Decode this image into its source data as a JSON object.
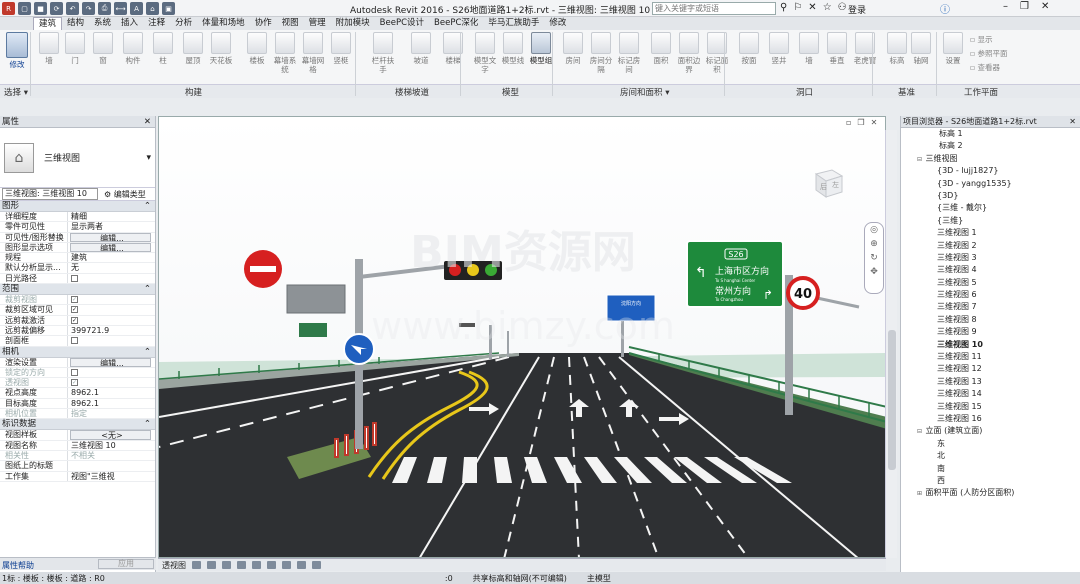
{
  "app": {
    "title": "Autodesk Revit 2016 -    S26地面道路1+2标.rvt - 三维视图: 三维视图 10",
    "search_placeholder": "键入关键字或短语",
    "login": "登录"
  },
  "tabs": [
    "建筑",
    "结构",
    "系统",
    "插入",
    "注释",
    "分析",
    "体量和场地",
    "协作",
    "视图",
    "管理",
    "附加模块",
    "BeePC设计",
    "BeePC深化",
    "毕马汇族助手",
    "修改"
  ],
  "active_tab": "建筑",
  "ribbon": {
    "modify": "修改",
    "select": "选择",
    "buttons": [
      "墙",
      "门",
      "窗",
      "构件",
      "柱",
      "屋顶",
      "天花板",
      "楼板",
      "幕墙系统",
      "幕墙网格",
      "竖梃",
      "栏杆扶手",
      "坡道",
      "楼梯",
      "模型文字",
      "模型线",
      "模型组",
      "房间",
      "房间分隔",
      "标记房间",
      "面积",
      "面积边界",
      "标记面积",
      "按面",
      "竖井",
      "墙",
      "垂直",
      "老虎窗",
      "标高",
      "轴网",
      "设置"
    ],
    "mini_buttons": [
      "显示",
      "参照平面",
      "查看器"
    ],
    "groups": [
      "构建",
      "楼梯坡道",
      "模型",
      "房间和面积",
      "洞口",
      "基准",
      "工作平面"
    ]
  },
  "properties": {
    "title": "属性",
    "type_name": "三维视图",
    "selector": "三维视图: 三维视图 10",
    "edit_type": "编辑类型",
    "help": "属性帮助",
    "apply": "应用",
    "sections": [
      {
        "name": "图形",
        "rows": [
          {
            "k": "详细程度",
            "v": "精细"
          },
          {
            "k": "零件可见性",
            "v": "显示两者"
          },
          {
            "k": "可见性/图形替换",
            "v": "编辑...",
            "btn": true
          },
          {
            "k": "图形显示选项",
            "v": "编辑...",
            "btn": true
          },
          {
            "k": "规程",
            "v": "建筑"
          },
          {
            "k": "默认分析显示...",
            "v": "无"
          },
          {
            "k": "日光路径",
            "v": "",
            "chk": false
          }
        ]
      },
      {
        "name": "范围",
        "rows": [
          {
            "k": "裁剪视图",
            "v": "",
            "chk": true,
            "dis": true
          },
          {
            "k": "裁剪区域可见",
            "v": "",
            "chk": true
          },
          {
            "k": "远剪裁激活",
            "v": "",
            "chk": true
          },
          {
            "k": "远剪裁偏移",
            "v": "399721.9"
          },
          {
            "k": "剖面框",
            "v": "",
            "chk": false
          }
        ]
      },
      {
        "name": "相机",
        "rows": [
          {
            "k": "渲染设置",
            "v": "编辑...",
            "btn": true
          },
          {
            "k": "锁定的方向",
            "v": "",
            "chk": false,
            "dis": true
          },
          {
            "k": "透视图",
            "v": "",
            "chk": true,
            "dis": true
          },
          {
            "k": "视点高度",
            "v": "8962.1"
          },
          {
            "k": "目标高度",
            "v": "8962.1"
          },
          {
            "k": "相机位置",
            "v": "指定",
            "dis": true
          }
        ]
      },
      {
        "name": "标识数据",
        "rows": [
          {
            "k": "视图样板",
            "v": "<无>",
            "btn": true
          },
          {
            "k": "视图名称",
            "v": "三维视图 10"
          },
          {
            "k": "相关性",
            "v": "不相关",
            "dis": true
          },
          {
            "k": "图纸上的标题",
            "v": ""
          },
          {
            "k": "工作集",
            "v": "视图\"三维视"
          }
        ]
      }
    ]
  },
  "browser": {
    "title": "项目浏览器 - S26地面道路1+2标.rvt",
    "items": [
      {
        "t": "标高 1",
        "lvl": 3
      },
      {
        "t": "标高 2",
        "lvl": 3
      },
      {
        "t": "三维视图",
        "lvl": 1,
        "tog": "⊟"
      },
      {
        "t": "{3D - lujj1827}",
        "lvl": 2
      },
      {
        "t": "{3D - yangg1535}",
        "lvl": 2
      },
      {
        "t": "{3D}",
        "lvl": 2
      },
      {
        "t": "{三维 - 戴尔}",
        "lvl": 2
      },
      {
        "t": "{三维}",
        "lvl": 2
      },
      {
        "t": "三维视图 1",
        "lvl": 2
      },
      {
        "t": "三维视图 2",
        "lvl": 2
      },
      {
        "t": "三维视图 3",
        "lvl": 2
      },
      {
        "t": "三维视图 4",
        "lvl": 2
      },
      {
        "t": "三维视图 5",
        "lvl": 2
      },
      {
        "t": "三维视图 6",
        "lvl": 2
      },
      {
        "t": "三维视图 7",
        "lvl": 2
      },
      {
        "t": "三维视图 8",
        "lvl": 2
      },
      {
        "t": "三维视图 9",
        "lvl": 2
      },
      {
        "t": "三维视图 10",
        "lvl": 2,
        "sel": true
      },
      {
        "t": "三维视图 11",
        "lvl": 2
      },
      {
        "t": "三维视图 12",
        "lvl": 2
      },
      {
        "t": "三维视图 13",
        "lvl": 2
      },
      {
        "t": "三维视图 14",
        "lvl": 2
      },
      {
        "t": "三维视图 15",
        "lvl": 2
      },
      {
        "t": "三维视图 16",
        "lvl": 2
      },
      {
        "t": "立面 (建筑立面)",
        "lvl": 1,
        "tog": "⊟"
      },
      {
        "t": "东",
        "lvl": 2
      },
      {
        "t": "北",
        "lvl": 2
      },
      {
        "t": "南",
        "lvl": 2
      },
      {
        "t": "西",
        "lvl": 2
      },
      {
        "t": "面积平面 (人防分区面积)",
        "lvl": 1,
        "tog": "⊞"
      }
    ]
  },
  "viewport": {
    "view_label": "透视图",
    "cube_top": "后",
    "cube_side": "左",
    "sign_gantry_code": "S26",
    "sign_line1": "上海市区方向",
    "sign_line1_en": "To S hanghai Center",
    "sign_line2": "常州方向",
    "sign_line2_en": "To Changzhou",
    "speed_limit": "40",
    "small_sign": "沈阳方向",
    "watermark1": "BIM资源网",
    "watermark2": "www.bimzy.com"
  },
  "status": {
    "left": "1标 : 楼板 : 楼板 : 道路 : R0",
    "mid": "共享标高和轴网(不可编辑)",
    "model": "主模型",
    "zero": ":0"
  }
}
